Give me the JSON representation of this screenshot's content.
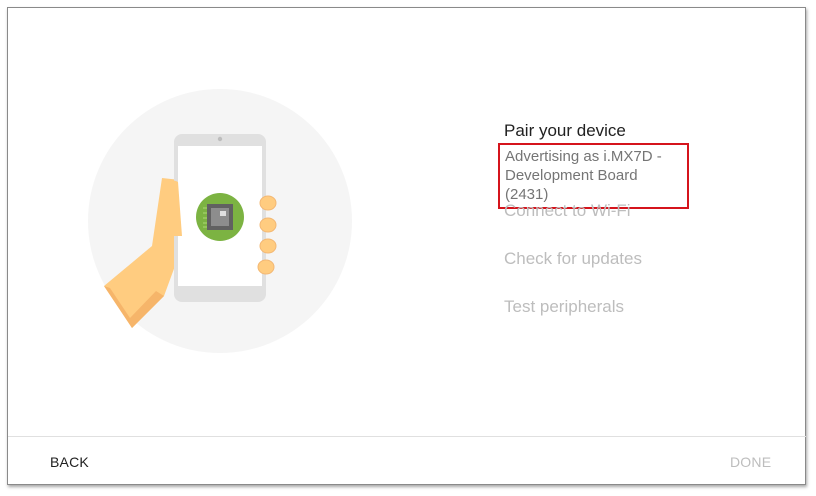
{
  "steps": {
    "current": {
      "title": "Pair your device",
      "subtitle_line1": "Advertising as i.MX7D -",
      "subtitle_line2": "Development Board (2431)"
    },
    "pending": [
      "Connect to Wi-Fi",
      "Check for updates",
      "Test peripherals"
    ]
  },
  "footer": {
    "back_label": "BACK",
    "done_label": "DONE"
  },
  "illustration": {
    "icon": "hand-holding-phone-with-chip-icon",
    "colors": {
      "circle": "#f5f5f5",
      "hand": "#ffcc80",
      "chip_badge": "#7cb342"
    }
  }
}
